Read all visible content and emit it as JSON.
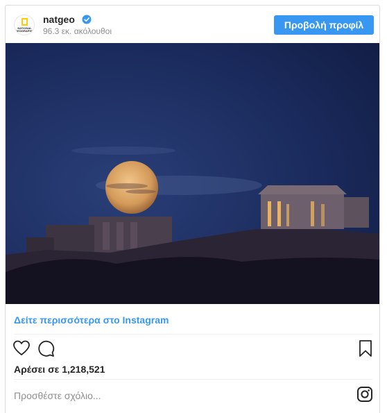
{
  "post": {
    "username": "natgeo",
    "verified": true,
    "followers": "96.3 εκ. ακόλουθοι",
    "view_profile_label": "Προβολή προφίλ",
    "avatar_text": "NATIONAL GEOGRAPHIC",
    "see_more_label": "Δείτε περισσότερα στο Instagram",
    "likes": "Αρέσει σε 1,218,521",
    "comment_placeholder": "Προσθέστε σχόλιο..."
  },
  "icons": {
    "verified": "verified-badge-icon",
    "like": "heart-icon",
    "comment": "comment-bubble-icon",
    "save": "bookmark-icon",
    "instagram": "instagram-icon"
  },
  "colors": {
    "accent": "#3897f0",
    "text": "#262626",
    "muted": "#8e8e8e",
    "border": "#dbdbdb",
    "verified": "#3897f0"
  }
}
